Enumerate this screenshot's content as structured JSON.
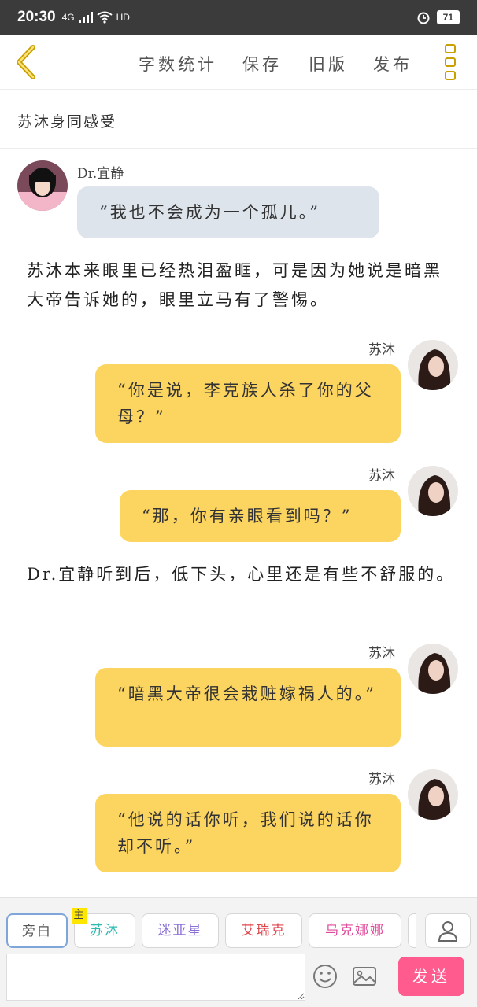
{
  "status_bar": {
    "time": "20:30",
    "network": "4G",
    "hd": "HD",
    "battery": "71"
  },
  "toolbar": {
    "word_count": "字数统计",
    "save": "保存",
    "old_version": "旧版",
    "publish": "发布"
  },
  "chapter": {
    "title": "苏沐身同感受"
  },
  "messages": [
    {
      "type": "dialog",
      "side": "left",
      "speaker": "Dr.宜静",
      "text": "“我也不会成为一个孤儿。”"
    },
    {
      "type": "narration",
      "text": "苏沐本来眼里已经热泪盈眶，可是因为她说是暗黑大帝告诉她的，眼里立马有了警惕。"
    },
    {
      "type": "dialog",
      "side": "right",
      "speaker": "苏沐",
      "text": "“你是说，李克族人杀了你的父母？”"
    },
    {
      "type": "dialog",
      "side": "right",
      "speaker": "苏沐",
      "text": "“那，你有亲眼看到吗？”"
    },
    {
      "type": "narration",
      "text": "Dr.宜静听到后，低下头，心里还是有些不舒服的。"
    },
    {
      "type": "dialog",
      "side": "right",
      "speaker": "苏沐",
      "text": "“暗黑大帝很会栽赃嫁祸人的。”"
    },
    {
      "type": "dialog",
      "side": "right",
      "speaker": "苏沐",
      "text": "“他说的话你听，我们说的话你却不听。”"
    }
  ],
  "roles": [
    {
      "label": "旁白",
      "color": "#555555"
    },
    {
      "label": "苏沐",
      "color": "#2fb8b0",
      "main_badge": "主"
    },
    {
      "label": "迷亚星",
      "color": "#8a6fd6"
    },
    {
      "label": "艾瑞克",
      "color": "#e0454b"
    },
    {
      "label": "乌克娜娜",
      "color": "#e04a9a"
    }
  ],
  "composer": {
    "placeholder": "",
    "send": "发送"
  },
  "colors": {
    "accent": "#fcd561",
    "send": "#ff5b8e",
    "grey_bubble": "#dde4ec"
  }
}
